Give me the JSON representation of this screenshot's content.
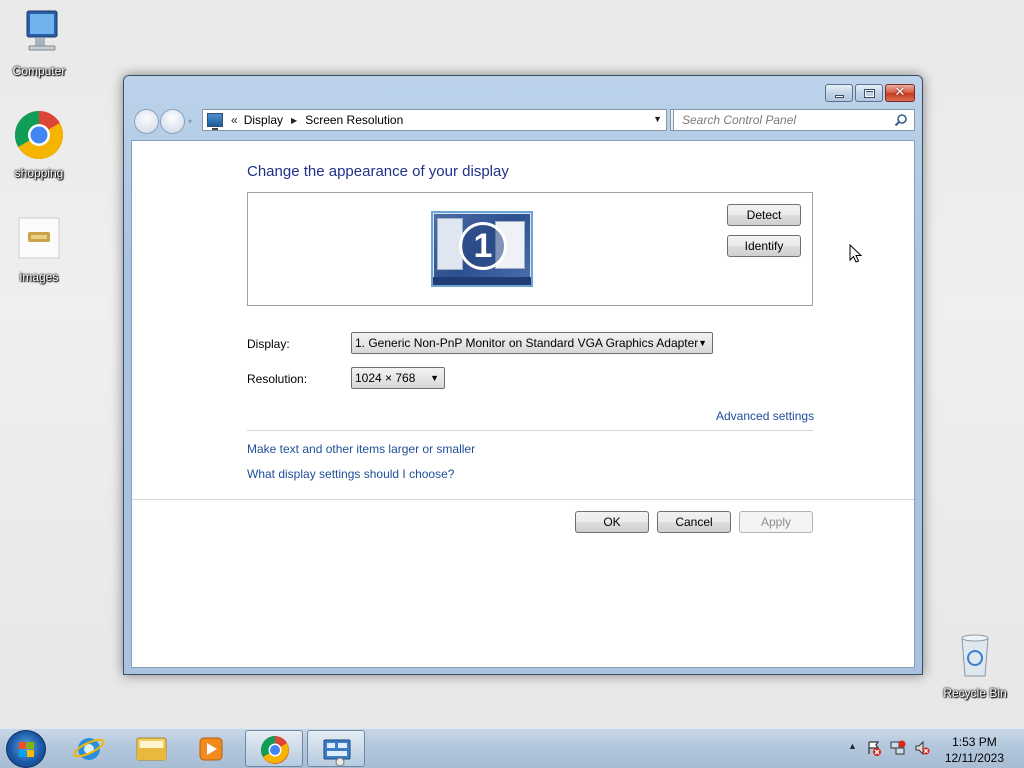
{
  "desktop": {
    "icons": [
      {
        "label": "Computer"
      },
      {
        "label": "shopping"
      },
      {
        "label": "images"
      },
      {
        "label": "Recycle Bin"
      }
    ]
  },
  "window": {
    "address": {
      "prefix": "«",
      "crumbs": [
        "Display",
        "Screen Resolution"
      ]
    },
    "search": {
      "placeholder": "Search Control Panel"
    },
    "content": {
      "heading": "Change the appearance of your display",
      "monitor_number": "1",
      "detect_label": "Detect",
      "identify_label": "Identify",
      "display_label": "Display:",
      "display_value": "1. Generic Non-PnP Monitor on Standard VGA Graphics Adapter",
      "resolution_label": "Resolution:",
      "resolution_value": "1024 × 768",
      "advanced_link": "Advanced settings",
      "links": [
        "Make text and other items larger or smaller",
        "What display settings should I choose?"
      ],
      "ok_label": "OK",
      "cancel_label": "Cancel",
      "apply_label": "Apply"
    }
  },
  "taskbar": {
    "clock": {
      "time": "1:53 PM",
      "date": "12/11/2023"
    }
  },
  "colors": {
    "heading": "#1e3287",
    "link": "#1e4e9a",
    "taskbar": "#b3c7dc"
  }
}
